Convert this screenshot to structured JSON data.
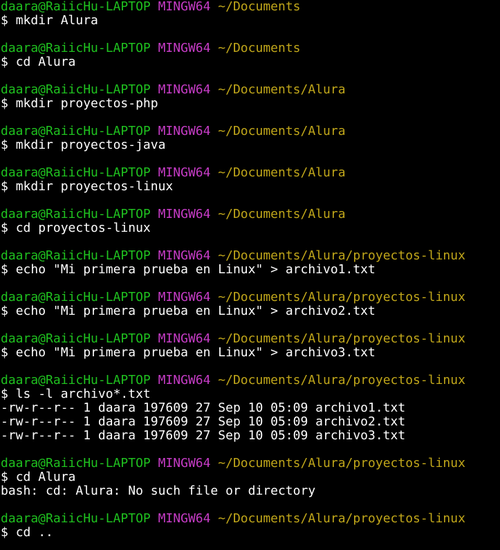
{
  "prompt": {
    "user": "daara@RaiicHu-LAPTOP",
    "host": "MINGW64",
    "symbol": "$"
  },
  "blocks": [
    {
      "path": "~/Documents",
      "command": "mkdir Alura",
      "output": []
    },
    {
      "path": "~/Documents",
      "command": "cd Alura",
      "output": []
    },
    {
      "path": "~/Documents/Alura",
      "command": "mkdir proyectos-php",
      "output": []
    },
    {
      "path": "~/Documents/Alura",
      "command": "mkdir proyectos-java",
      "output": []
    },
    {
      "path": "~/Documents/Alura",
      "command": "mkdir proyectos-linux",
      "output": []
    },
    {
      "path": "~/Documents/Alura",
      "command": "cd proyectos-linux",
      "output": []
    },
    {
      "path": "~/Documents/Alura/proyectos-linux",
      "command": "echo \"Mi primera prueba en Linux\" > archivo1.txt",
      "output": []
    },
    {
      "path": "~/Documents/Alura/proyectos-linux",
      "command": "echo \"Mi primera prueba en Linux\" > archivo2.txt",
      "output": []
    },
    {
      "path": "~/Documents/Alura/proyectos-linux",
      "command": "echo \"Mi primera prueba en Linux\" > archivo3.txt",
      "output": []
    },
    {
      "path": "~/Documents/Alura/proyectos-linux",
      "command": "ls -l archivo*.txt",
      "output": [
        "-rw-r--r-- 1 daara 197609 27 Sep 10 05:09 archivo1.txt",
        "-rw-r--r-- 1 daara 197609 27 Sep 10 05:09 archivo2.txt",
        "-rw-r--r-- 1 daara 197609 27 Sep 10 05:09 archivo3.txt"
      ]
    },
    {
      "path": "~/Documents/Alura/proyectos-linux",
      "command": "cd Alura",
      "output": [
        "bash: cd: Alura: No such file or directory"
      ]
    },
    {
      "path": "~/Documents/Alura/proyectos-linux",
      "command": "cd ..",
      "output": []
    }
  ],
  "colors": {
    "background": "#000000",
    "user": "#1fc11f",
    "host": "#c63cc6",
    "path": "#c0a61a",
    "text": "#ffffff"
  }
}
